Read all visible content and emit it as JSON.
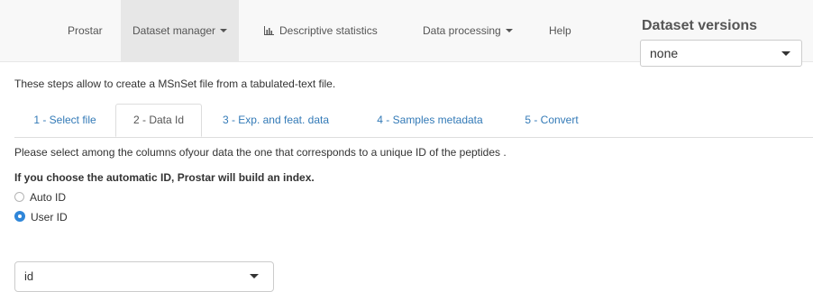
{
  "navbar": {
    "brand": "Prostar",
    "items": [
      {
        "label": "Dataset manager"
      },
      {
        "label": "Descriptive statistics"
      },
      {
        "label": "Data processing"
      },
      {
        "label": "Help"
      }
    ],
    "active_item": "Dataset manager"
  },
  "dataset_versions": {
    "title": "Dataset versions",
    "selected": "none"
  },
  "intro_text": "These steps allow to create a MSnSet file from a tabulated-text file.",
  "tabs": [
    {
      "label": "1 - Select file"
    },
    {
      "label": "2 - Data Id"
    },
    {
      "label": "3 - Exp. and feat. data"
    },
    {
      "label": "4 - Samples metadata"
    },
    {
      "label": "5 - Convert"
    }
  ],
  "active_tab": "2 - Data Id",
  "help_text": "Please select among the columns ofyour data the one that corresponds to a unique ID of the peptides .",
  "bold_text": "If you choose the automatic ID, Prostar will build an index.",
  "radio_options": [
    {
      "label": "Auto ID",
      "checked": false
    },
    {
      "label": "User ID",
      "checked": true
    }
  ],
  "id_column_select": {
    "selected": "id"
  },
  "colors": {
    "accent": "#2f86d9",
    "link": "#337ab7",
    "navbar_bg": "#f8f8f8",
    "navbar_active_bg": "#e7e7e7"
  }
}
